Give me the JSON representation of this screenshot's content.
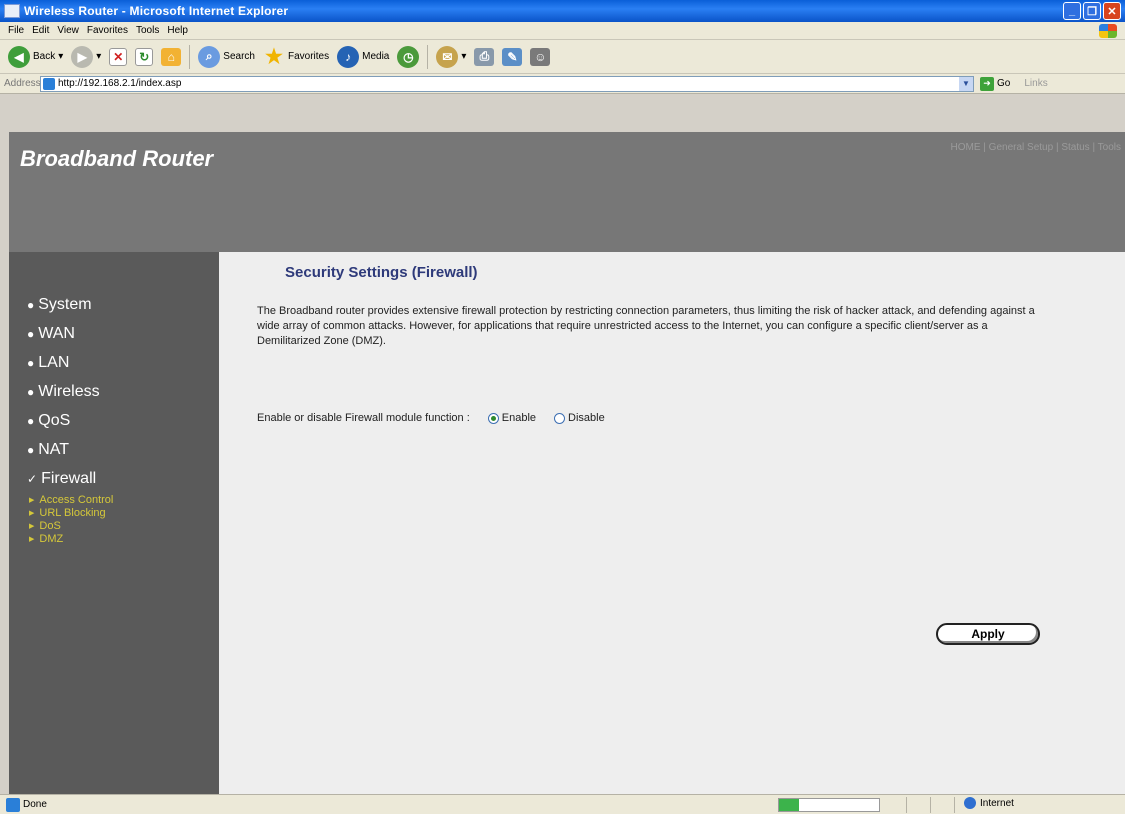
{
  "window": {
    "title": "Wireless Router - Microsoft Internet Explorer"
  },
  "menu": [
    "File",
    "Edit",
    "View",
    "Favorites",
    "Tools",
    "Help"
  ],
  "toolbar": {
    "back": "Back",
    "search": "Search",
    "favorites": "Favorites",
    "media": "Media"
  },
  "address": {
    "label": "Address",
    "url": "http://192.168.2.1/index.asp",
    "go": "Go",
    "links": "Links"
  },
  "router": {
    "title": "Broadband Router",
    "nav": "HOME | General Setup | Status | Tools"
  },
  "sidebar": {
    "items": [
      {
        "label": "System",
        "bullet": "●"
      },
      {
        "label": "WAN",
        "bullet": "●"
      },
      {
        "label": "LAN",
        "bullet": "●"
      },
      {
        "label": "Wireless",
        "bullet": "●"
      },
      {
        "label": "QoS",
        "bullet": "●"
      },
      {
        "label": "NAT",
        "bullet": "●"
      },
      {
        "label": "Firewall",
        "bullet": "✓"
      }
    ],
    "subitems": [
      "Access Control",
      "URL Blocking",
      "DoS",
      "DMZ"
    ]
  },
  "page": {
    "title": "Security Settings (Firewall)",
    "description": "The Broadband router provides extensive firewall protection by restricting connection parameters, thus limiting the risk of hacker attack, and defending against a wide array of common attacks. However, for applications that require unrestricted access to the Internet, you can configure a specific client/server as a Demilitarized Zone (DMZ).",
    "firewall_label": "Enable or disable Firewall module function :",
    "enable_label": "Enable",
    "disable_label": "Disable",
    "firewall_enabled": true,
    "apply_label": "Apply"
  },
  "status": {
    "text": "Done",
    "zone": "Internet",
    "progress": 0.2
  },
  "colors": {
    "sidebar_bg": "#5a5a5a",
    "header_bg": "#777777",
    "submenu_text": "#d5c83a",
    "title_text": "#2e3a7a"
  }
}
